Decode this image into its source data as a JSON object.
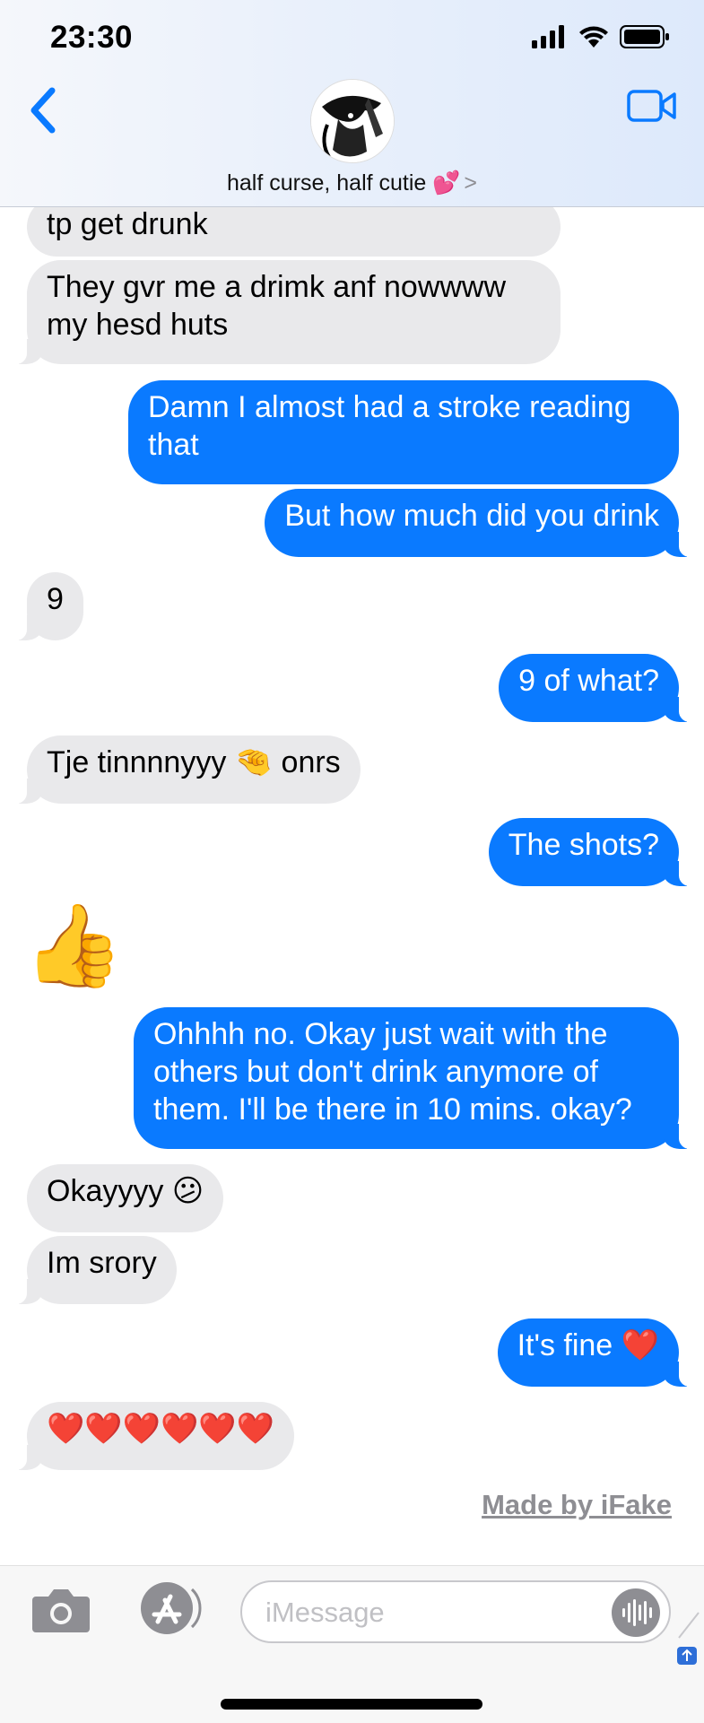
{
  "status_bar": {
    "time": "23:30"
  },
  "header": {
    "contact_name": "half curse, half cutie 💕",
    "chevron": ">"
  },
  "messages": [
    {
      "from": "them",
      "text": "tp get drunk"
    },
    {
      "from": "them",
      "text": "They gvr me a drimk anf nowwww my hesd huts"
    },
    {
      "from": "me",
      "text": "Damn I almost had a stroke reading that"
    },
    {
      "from": "me",
      "text": "But how much did you drink"
    },
    {
      "from": "them",
      "text": "9"
    },
    {
      "from": "me",
      "text": "9 of what?"
    },
    {
      "from": "them",
      "text": "Tje tinnnnyyy 🤏 onrs"
    },
    {
      "from": "me",
      "text": "The shots?"
    },
    {
      "from": "them",
      "text": "👍"
    },
    {
      "from": "me",
      "text": "Ohhhh no. Okay just wait with the others but don't drink anymore of them. I'll be there in 10 mins. okay?"
    },
    {
      "from": "them",
      "text": "Okayyyy 😕"
    },
    {
      "from": "them",
      "text": "Im srory"
    },
    {
      "from": "me",
      "text": "It's fine ❤️"
    },
    {
      "from": "them",
      "text": "❤️❤️❤️❤️❤️❤️"
    }
  ],
  "watermark": "Made by iFake",
  "input": {
    "placeholder": "iMessage",
    "value": ""
  },
  "icons": {
    "back": "chevron-left-icon",
    "video": "video-camera-icon",
    "camera": "camera-icon",
    "apps": "app-store-icon",
    "audio": "audio-waveform-icon"
  },
  "colors": {
    "accent": "#0a7aff",
    "incoming_bubble": "#e9e9eb"
  }
}
